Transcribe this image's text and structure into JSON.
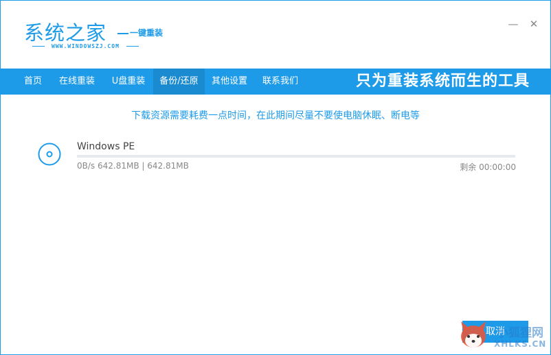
{
  "header": {
    "logo_title": "系统之家",
    "logo_subtitle": "一键重装",
    "logo_url": "WWW.WINDOWSZJ.COM",
    "minimize_glyph": "—",
    "close_glyph": "✕"
  },
  "nav": {
    "items": [
      {
        "label": "首页"
      },
      {
        "label": "在线重装"
      },
      {
        "label": "U盘重装"
      },
      {
        "label": "备份/还原"
      },
      {
        "label": "其他设置"
      },
      {
        "label": "联系我们"
      }
    ],
    "active_index": 3,
    "slogan": "只为重装系统而生的工具"
  },
  "main": {
    "notice": "下载资源需要耗费一点时间，在此期间尽量不要使电脑休眠、断电等",
    "download": {
      "icon": "disc-icon",
      "name": "Windows PE",
      "progress": 0,
      "stats": "0B/s 642.81MB | 642.81MB",
      "remaining": "剩余 00:00:00"
    }
  },
  "footer": {
    "cancel_label": "取消"
  },
  "watermark": {
    "icon": "fox-logo-icon",
    "text_cn": "小狐狸网",
    "text_en": "XHLKS.CN"
  },
  "colors": {
    "accent": "#1e9be8",
    "text_muted": "#888888"
  }
}
